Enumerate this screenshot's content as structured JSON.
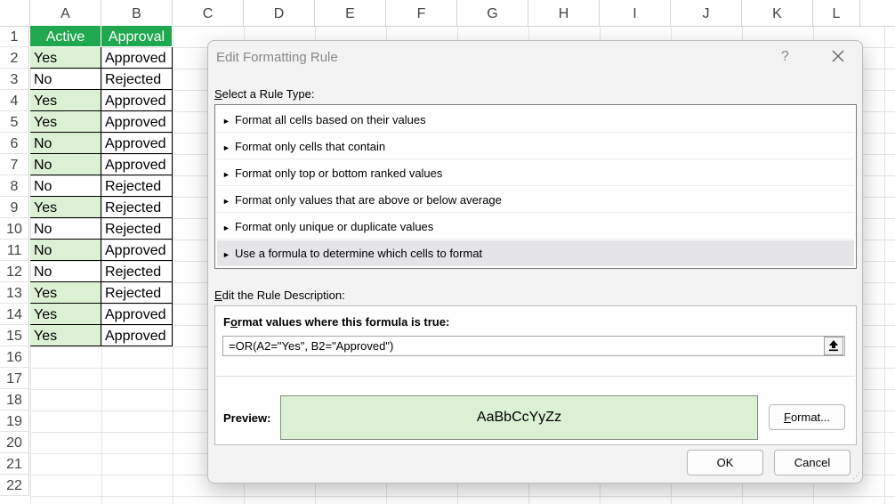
{
  "columns": [
    "A",
    "B",
    "C",
    "D",
    "E",
    "F",
    "G",
    "H",
    "I",
    "J",
    "K",
    "L"
  ],
  "rows": [
    "1",
    "2",
    "3",
    "4",
    "5",
    "6",
    "7",
    "8",
    "9",
    "10",
    "11",
    "12",
    "13",
    "14",
    "15",
    "16",
    "17",
    "18",
    "19",
    "20",
    "21",
    "22"
  ],
  "table": {
    "headers": [
      "Active",
      "Approval"
    ],
    "data": [
      [
        "Yes",
        "Approved"
      ],
      [
        "No",
        "Rejected"
      ],
      [
        "Yes",
        "Approved"
      ],
      [
        "Yes",
        "Approved"
      ],
      [
        "No",
        "Approved"
      ],
      [
        "No",
        "Approved"
      ],
      [
        "No",
        "Rejected"
      ],
      [
        "Yes",
        "Rejected"
      ],
      [
        "No",
        "Rejected"
      ],
      [
        "No",
        "Approved"
      ],
      [
        "No",
        "Rejected"
      ],
      [
        "Yes",
        "Rejected"
      ],
      [
        "Yes",
        "Approved"
      ],
      [
        "Yes",
        "Approved"
      ]
    ],
    "highlighted": [
      true,
      false,
      true,
      true,
      true,
      true,
      false,
      true,
      false,
      true,
      false,
      true,
      true,
      true
    ]
  },
  "colors": {
    "header_green": "#1fa84f",
    "highlight": "#dcf1d4"
  },
  "dialog": {
    "title": "Edit Formatting Rule",
    "help": "?",
    "close_icon": "close-icon",
    "rule_type_label_u": "S",
    "rule_type_label": "elect a Rule Type:",
    "rule_types": [
      "Format all cells based on their values",
      "Format only cells that contain",
      "Format only top or bottom ranked values",
      "Format only values that are above or below average",
      "Format only unique or duplicate values",
      "Use a formula to determine which cells to format"
    ],
    "selected_rule_index": 5,
    "arrow_glyph": "►",
    "description_label_u": "E",
    "description_label": "dit the Rule Description:",
    "formula_title_a": "F",
    "formula_title_u": "o",
    "formula_title_b": "rmat values where this formula is true:",
    "formula": "=OR(A2=\"Yes\", B2=\"Approved\")",
    "preview_label": "Preview:",
    "preview_text": "AaBbCcYyZz",
    "format_button_u": "F",
    "format_button": "ormat...",
    "ok_button": "OK",
    "cancel_button": "Cancel"
  }
}
